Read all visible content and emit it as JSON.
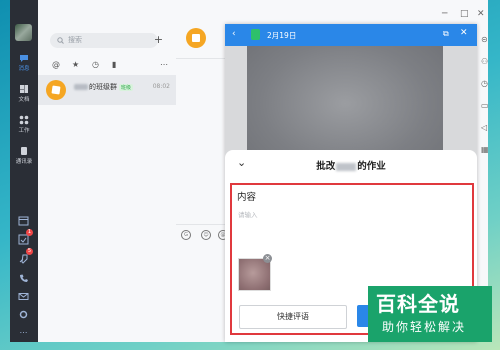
{
  "nav": {
    "items": [
      {
        "label": "消息",
        "icon": "chat-icon"
      },
      {
        "label": "文档",
        "icon": "document-icon"
      },
      {
        "label": "工作",
        "icon": "grid-icon"
      },
      {
        "label": "通讯录",
        "icon": "contacts-icon"
      }
    ],
    "badge_1": "1",
    "badge_2": "5"
  },
  "list": {
    "search_placeholder": "搜索",
    "plus": "+",
    "chat": {
      "name_visible": "的班级群",
      "tag": "班级",
      "time": "08:02"
    }
  },
  "panel": {
    "title": "2月19日",
    "sheet_title_prefix": "批改",
    "sheet_title_suffix": "的作业",
    "content_label": "内容",
    "input_placeholder": "请输入",
    "quick_comment_button": "快捷评语"
  },
  "window": {
    "minimize": "─",
    "maximize": "□",
    "close": "✕"
  },
  "watermark": {
    "line1": "百科全说",
    "line2": "助你轻松解决"
  }
}
